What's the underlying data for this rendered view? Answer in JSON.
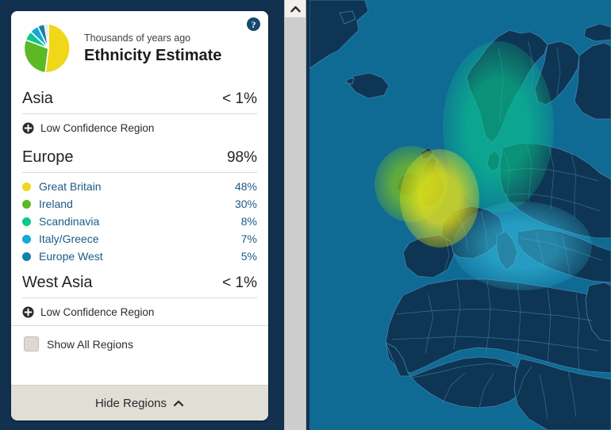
{
  "window": {
    "background_color": "#12314f"
  },
  "panel": {
    "help_icon_label": "?",
    "header": {
      "eyebrow": "Thousands of years ago",
      "title": "Ethnicity Estimate"
    },
    "sections": [
      {
        "name": "Asia",
        "percent": "< 1%",
        "low_confidence_label": "Low Confidence Region"
      },
      {
        "name": "Europe",
        "percent": "98%"
      },
      {
        "name": "West Asia",
        "percent": "< 1%",
        "low_confidence_label": "Low Confidence Region"
      }
    ],
    "sub_regions": [
      {
        "name": "Great Britain",
        "percent": "48%",
        "color": "#f0d71a"
      },
      {
        "name": "Ireland",
        "percent": "30%",
        "color": "#5cb925"
      },
      {
        "name": "Scandinavia",
        "percent": "8%",
        "color": "#09c98f"
      },
      {
        "name": "Italy/Greece",
        "percent": "7%",
        "color": "#12a9d6"
      },
      {
        "name": "Europe West",
        "percent": "5%",
        "color": "#1580a8"
      }
    ],
    "show_all_regions_label": "Show All Regions",
    "show_all_regions_checked": false,
    "footer_label": "Hide Regions"
  },
  "map": {
    "ocean_color": "#0f6a94",
    "land_color": "#0f3554",
    "border_color": "#3d86ab",
    "overlays": [
      {
        "region": "Scandinavia",
        "color": "#09c98f"
      },
      {
        "region": "Great Britain",
        "color": "#f0d71a"
      },
      {
        "region": "Ireland",
        "color": "#5cb925"
      },
      {
        "region": "Italy/Greece",
        "color": "#12a9d6"
      }
    ]
  },
  "scrollbar": {
    "track_color": "#cfcfcf",
    "thumb_color": "#cdcdcd"
  },
  "chart_data": {
    "type": "pie",
    "title": "Ethnicity Estimate",
    "subtitle": "Thousands of years ago",
    "categories": [
      "Great Britain",
      "Ireland",
      "Scandinavia",
      "Italy/Greece",
      "Europe West"
    ],
    "values": [
      48,
      30,
      8,
      7,
      5
    ],
    "colors": [
      "#f0d71a",
      "#5cb925",
      "#09c98f",
      "#12a9d6",
      "#1580a8"
    ],
    "unit": "%",
    "legend": "right-aligned list",
    "notes": "Europe totals 98%; Asia < 1%; West Asia < 1%"
  }
}
